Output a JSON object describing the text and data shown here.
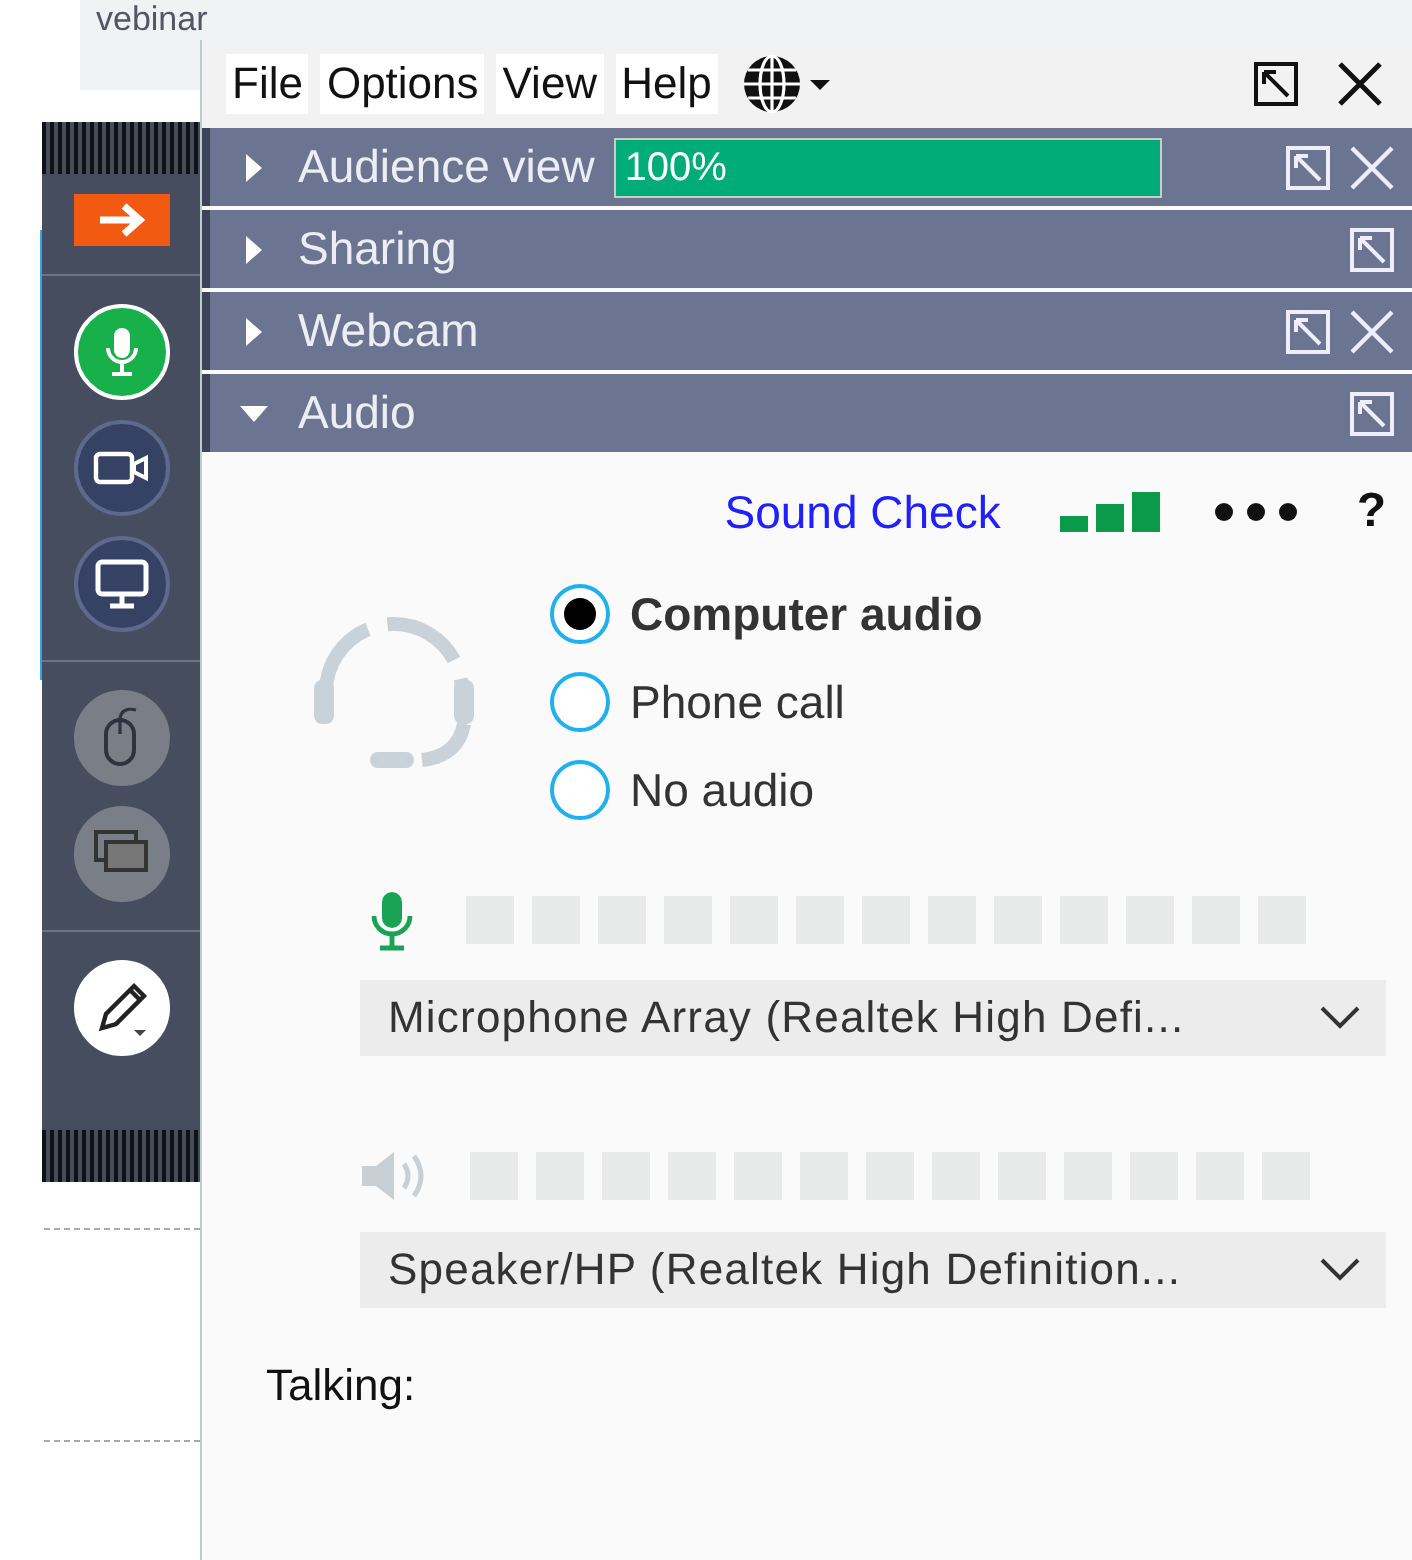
{
  "background": {
    "tab_text": "vebinar"
  },
  "menu": [
    "File",
    "Options",
    "View",
    "Help"
  ],
  "sidebar": {
    "buttons": [
      {
        "kind": "arrow",
        "on": false,
        "disabled": false
      },
      {
        "kind": "mic",
        "on": true,
        "disabled": false
      },
      {
        "kind": "camera",
        "on": false,
        "disabled": false
      },
      {
        "kind": "screen",
        "on": false,
        "disabled": false
      },
      {
        "kind": "mouse",
        "on": false,
        "disabled": true
      },
      {
        "kind": "windows",
        "on": false,
        "disabled": true
      },
      {
        "kind": "pencil",
        "on": false,
        "disabled": false
      }
    ]
  },
  "sections": [
    {
      "title": "Audience view",
      "expanded": false,
      "closable": true,
      "progress": {
        "text": "100%",
        "level": 1
      }
    },
    {
      "title": "Sharing",
      "expanded": false,
      "closable": false
    },
    {
      "title": "Webcam",
      "expanded": false,
      "closable": true
    },
    {
      "title": "Audio",
      "expanded": true,
      "closable": false
    }
  ],
  "audio": {
    "sound_check": "Sound Check",
    "help": "?",
    "options": [
      {
        "label": "Computer audio",
        "selected": true
      },
      {
        "label": "Phone call",
        "selected": false
      },
      {
        "label": "No audio",
        "selected": false
      }
    ],
    "microphone": {
      "device": "Microphone Array (Realtek High Defi..."
    },
    "speaker": {
      "device": "Speaker/HP (Realtek High Definition..."
    },
    "talking": "Talking:"
  }
}
